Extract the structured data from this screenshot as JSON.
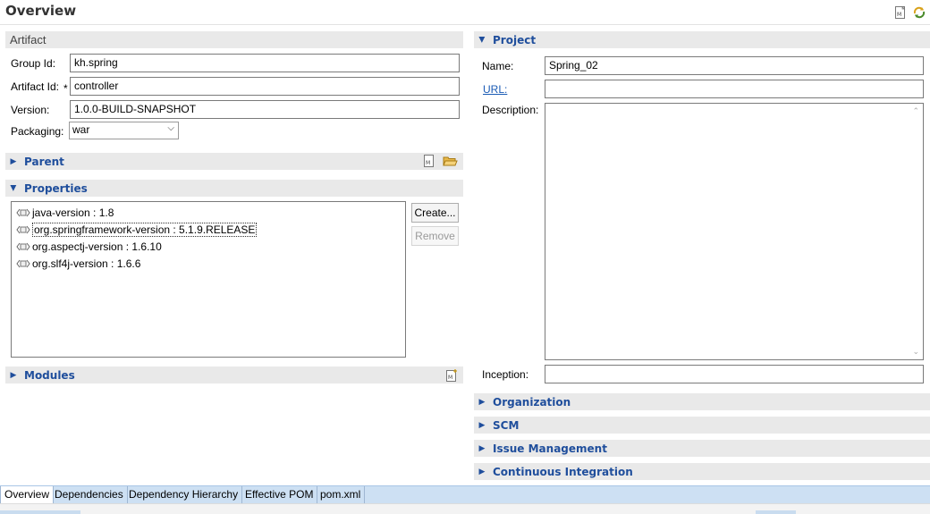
{
  "page": {
    "title": "Overview"
  },
  "toolbar": {
    "icons": [
      "pom-xml-icon",
      "refresh-sync-icon"
    ]
  },
  "artifact": {
    "header": "Artifact",
    "group_id_label": "Group Id:",
    "group_id_value": "kh.spring",
    "artifact_id_label": "Artifact Id:",
    "artifact_id_required": "*",
    "artifact_id_value": "controller",
    "version_label": "Version:",
    "version_value": "1.0.0-BUILD-SNAPSHOT",
    "packaging_label": "Packaging:",
    "packaging_value": "war"
  },
  "parent": {
    "header": "Parent"
  },
  "properties": {
    "header": "Properties",
    "items": [
      "java-version : 1.8",
      "org.springframework-version : 5.1.9.RELEASE",
      "org.aspectj-version : 1.6.10",
      "org.slf4j-version : 1.6.6"
    ],
    "selected_index": 1,
    "create_label": "Create...",
    "remove_label": "Remove"
  },
  "modules": {
    "header": "Modules"
  },
  "project": {
    "header": "Project",
    "name_label": "Name:",
    "name_value": "Spring_02",
    "url_label": "URL:",
    "url_value": "",
    "description_label": "Description:",
    "description_value": "",
    "inception_label": "Inception:",
    "inception_value": ""
  },
  "collapsed_sections": [
    "Organization",
    "SCM",
    "Issue Management",
    "Continuous Integration"
  ],
  "tabs": [
    "Overview",
    "Dependencies",
    "Dependency Hierarchy",
    "Effective POM",
    "pom.xml"
  ],
  "active_tab": "Overview",
  "colors": {
    "section_title": "#1f4e9c",
    "section_bg": "#e9e9e9",
    "tabbar_bg": "#cde0f3"
  }
}
